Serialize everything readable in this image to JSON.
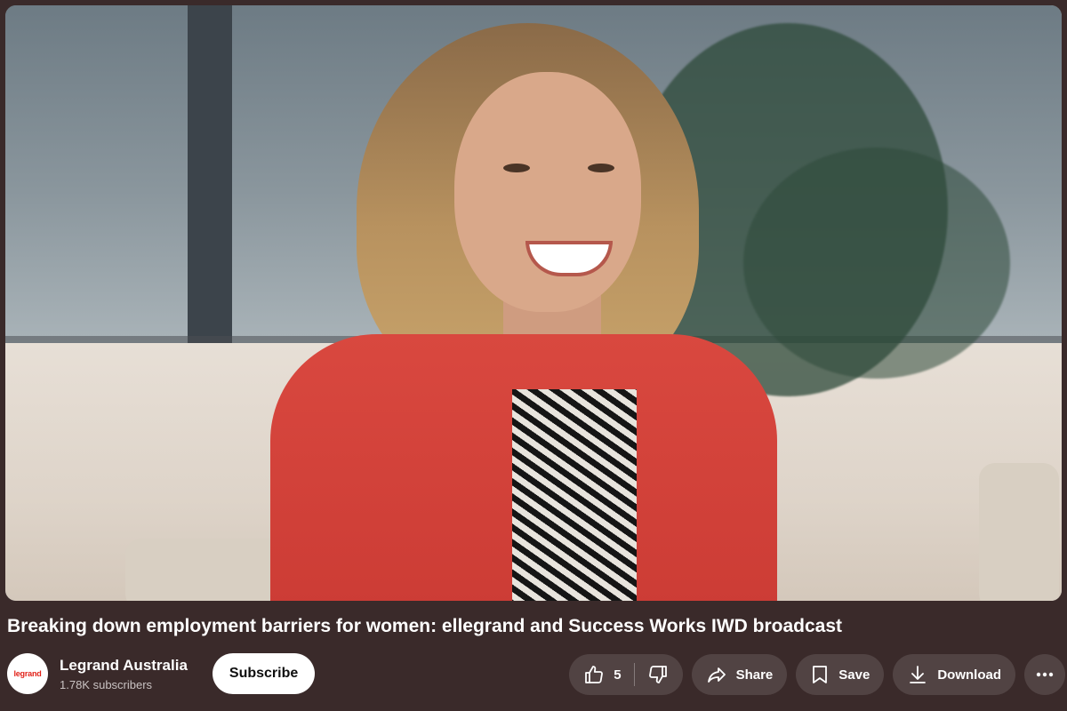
{
  "video": {
    "title": "Breaking down employment barriers for women: ellegrand and Success Works IWD broadcast"
  },
  "channel": {
    "avatar_text": "legrand",
    "name": "Legrand Australia",
    "subscribers": "1.78K subscribers",
    "subscribe_label": "Subscribe"
  },
  "actions": {
    "like_count": "5",
    "share_label": "Share",
    "save_label": "Save",
    "download_label": "Download"
  },
  "icons": {
    "like": "thumbs-up-icon",
    "dislike": "thumbs-down-icon",
    "share": "share-arrow-icon",
    "save": "bookmark-icon",
    "download": "download-arrow-icon",
    "more": "more-horizontal-icon"
  },
  "colors": {
    "background": "#3a2a2a",
    "button_bg": "rgba(255,255,255,0.12)",
    "subscribe_bg": "#ffffff",
    "brand_red": "#e2231a"
  }
}
